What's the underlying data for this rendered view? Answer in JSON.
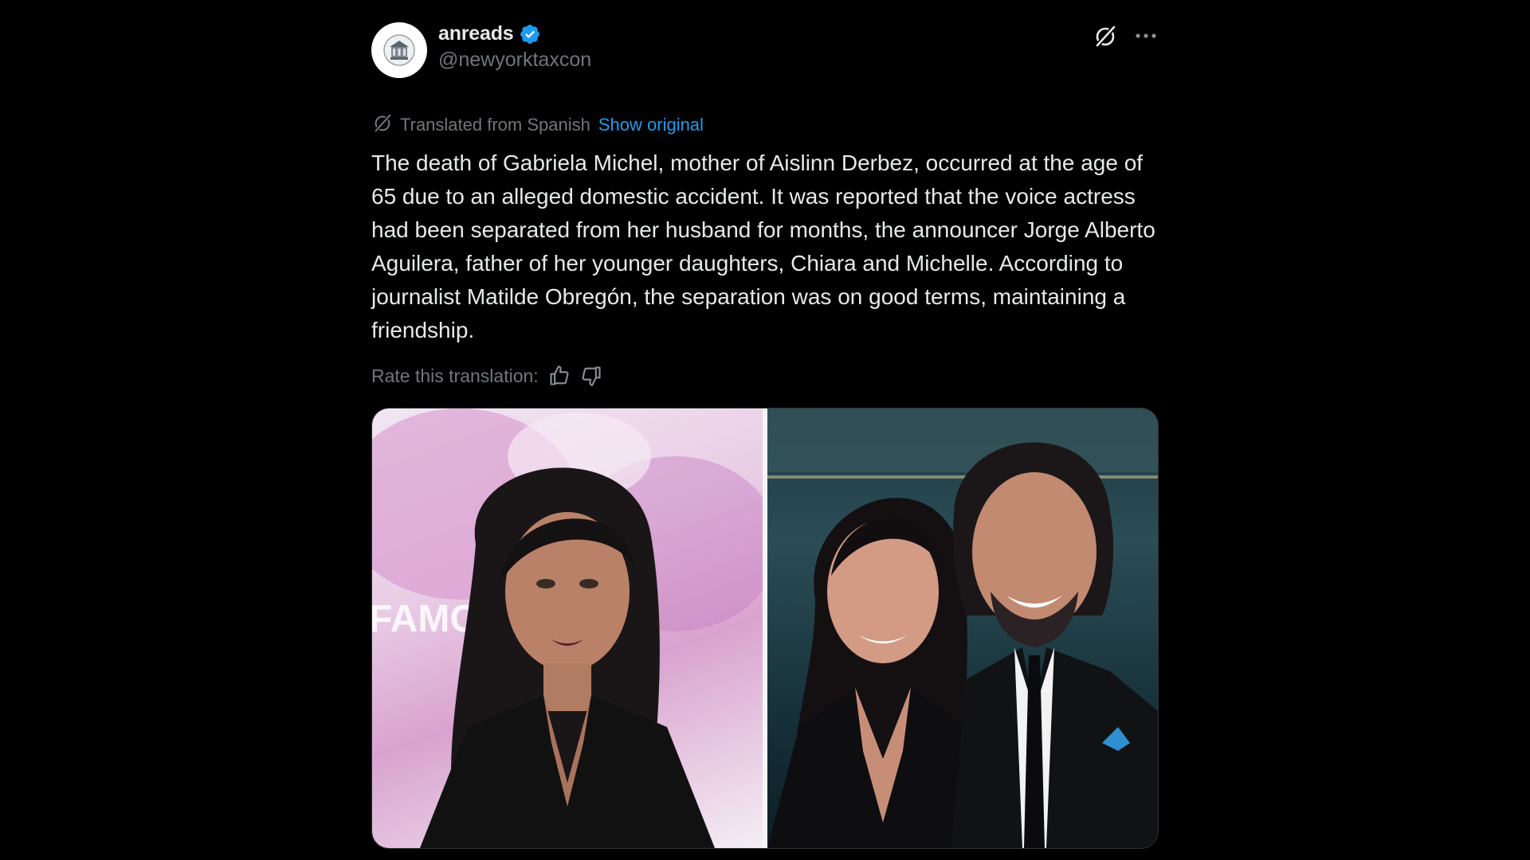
{
  "post": {
    "author": {
      "display_name": "anreads",
      "handle": "@newyorktaxcon",
      "verified": true,
      "verified_color": "#1d9bf0"
    },
    "header_icons": [
      "grok-slash-icon",
      "more-options-icon"
    ],
    "translation": {
      "label": "Translated from Spanish",
      "show_original_label": "Show original",
      "icon": "translate-icon"
    },
    "text": "The death of Gabriela Michel, mother of Aislinn Derbez, occurred at the age of 65 due to an alleged domestic accident. It was reported that the voice actress had been separated from her husband for months, the announcer Jorge Alberto Aguilera, father of her younger daughters, Chiara and Michelle. According to journalist Matilde Obregón, the separation was on good terms, maintaining a friendship.",
    "rate": {
      "label": "Rate this translation:",
      "icons": [
        "thumbs-up-icon",
        "thumbs-down-icon"
      ]
    },
    "media": {
      "photos": [
        "woman-portrait-photo",
        "couple-portrait-photo"
      ],
      "left_photo_text": "FAMC"
    }
  },
  "colors": {
    "background": "#000000",
    "text_primary": "#e7e9ea",
    "text_secondary": "#71767b",
    "link": "#1d9bf0"
  }
}
